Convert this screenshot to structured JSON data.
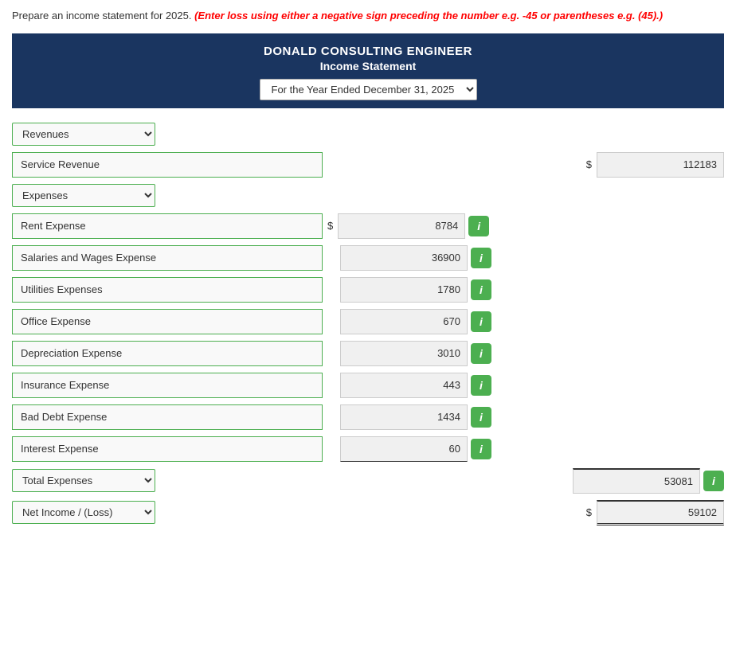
{
  "instructions": {
    "text": "Prepare an income statement for 2025.",
    "highlight": "(Enter loss using either a negative sign preceding the number e.g. -45 or parentheses e.g. (45).)"
  },
  "header": {
    "company": "DONALD CONSULTING ENGINEER",
    "statement": "Income Statement",
    "period_label": "For the Year Ended December 31, 2025"
  },
  "revenues_section": {
    "label": "Revenues",
    "dropdown_options": [
      "Revenues"
    ]
  },
  "service_revenue": {
    "label": "Service Revenue",
    "value": "112183"
  },
  "expenses_section": {
    "label": "Expenses",
    "dropdown_options": [
      "Expenses"
    ]
  },
  "expense_lines": [
    {
      "label": "Rent Expense",
      "value": "8784",
      "show_dollar": true
    },
    {
      "label": "Salaries and Wages Expense",
      "value": "36900",
      "show_dollar": false
    },
    {
      "label": "Utilities Expenses",
      "value": "1780",
      "show_dollar": false
    },
    {
      "label": "Office Expense",
      "value": "670",
      "show_dollar": false
    },
    {
      "label": "Depreciation Expense",
      "value": "3010",
      "show_dollar": false
    },
    {
      "label": "Insurance Expense",
      "value": "443",
      "show_dollar": false
    },
    {
      "label": "Bad Debt Expense",
      "value": "1434",
      "show_dollar": false
    },
    {
      "label": "Interest Expense",
      "value": "60",
      "show_dollar": false
    }
  ],
  "total_expenses": {
    "label": "Total Expenses",
    "value": "53081"
  },
  "net_income": {
    "label": "Net Income / (Loss)",
    "value": "59102"
  }
}
